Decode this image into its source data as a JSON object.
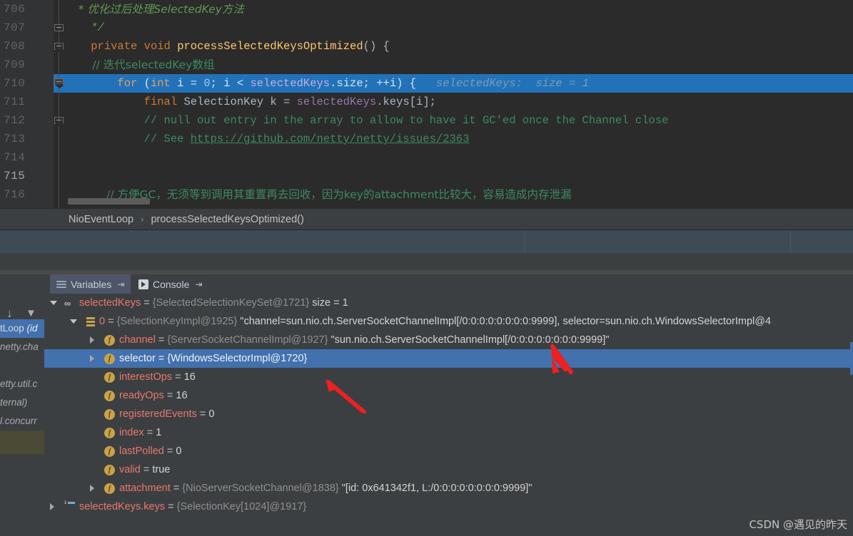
{
  "editor": {
    "lines": [
      {
        "num": "706",
        "segments": [
          {
            "t": "    * 优化过后处理SelectedKey方法",
            "c": "cmt"
          }
        ]
      },
      {
        "num": "707",
        "segments": [
          {
            "t": "    */",
            "c": "cmt"
          }
        ]
      },
      {
        "num": "708",
        "segments": [
          {
            "t": "    ",
            "c": "ident"
          },
          {
            "t": "private",
            "c": "kw"
          },
          {
            "t": " ",
            "c": "ident"
          },
          {
            "t": "void",
            "c": "kw"
          },
          {
            "t": " ",
            "c": "ident"
          },
          {
            "t": "processSelectedKeysOptimized",
            "c": "meth"
          },
          {
            "t": "() {",
            "c": "ident"
          }
        ]
      },
      {
        "num": "709",
        "segments": [
          {
            "t": "        // 迭代selectedKey数组",
            "c": "cmt-plain"
          }
        ]
      },
      {
        "num": "710",
        "segments": [
          {
            "t": "        ",
            "c": "on-hl"
          },
          {
            "t": "for",
            "c": "on-hl-kw"
          },
          {
            "t": " (",
            "c": "on-hl"
          },
          {
            "t": "int",
            "c": "on-hl-kw"
          },
          {
            "t": " i = ",
            "c": "on-hl"
          },
          {
            "t": "0",
            "c": "on-hl-num"
          },
          {
            "t": "; i < ",
            "c": "on-hl"
          },
          {
            "t": "selectedKeys",
            "c": "on-hl-fld"
          },
          {
            "t": ".size; ++i) {",
            "c": "on-hl"
          },
          {
            "t": "   selectedKeys:  size = 1",
            "c": "hint"
          }
        ]
      },
      {
        "num": "711",
        "segments": [
          {
            "t": "            ",
            "c": "ident"
          },
          {
            "t": "final",
            "c": "kw"
          },
          {
            "t": " SelectionKey k = ",
            "c": "ident"
          },
          {
            "t": "selectedKeys",
            "c": "fld"
          },
          {
            "t": ".keys[",
            "c": "ident"
          },
          {
            "t": "i",
            "c": "ident"
          },
          {
            "t": "];",
            "c": "ident"
          }
        ]
      },
      {
        "num": "712",
        "segments": [
          {
            "t": "            // null out entry in the array to allow to have it GC'ed once the Channel close",
            "c": "cmt-plain"
          }
        ]
      },
      {
        "num": "713",
        "segments": [
          {
            "t": "            // See ",
            "c": "cmt-plain"
          },
          {
            "t": "https://github.com/netty/netty/issues/2363",
            "c": "link"
          }
        ]
      },
      {
        "num": "714",
        "segments": []
      },
      {
        "num": "715",
        "segments": []
      },
      {
        "num": "716",
        "segments": [
          {
            "t": "            // 方便GC，无须等到调用其重置再去回收，因为key的attachment比较大，容易造成内存泄漏",
            "c": "cmt-plain"
          }
        ]
      }
    ],
    "highlight_line": "710",
    "inline_hint": "selectedKeys:  size = 1"
  },
  "breadcrumb": {
    "items": [
      "NioEventLoop",
      "processSelectedKeysOptimized()"
    ],
    "separator": "›"
  },
  "debug_tabs": [
    {
      "label": "Variables",
      "icon": "variables-icon",
      "pin": "⇥",
      "active": true
    },
    {
      "label": "Console",
      "icon": "console-icon",
      "pin": "⇥",
      "active": false
    }
  ],
  "left_rail": {
    "buttons": [
      {
        "name": "step-down-icon",
        "glyph": "↓"
      },
      {
        "name": "filter-icon",
        "glyph": "▼"
      }
    ],
    "frames": [
      {
        "text": "tLoop (id",
        "selected": true,
        "lead": "tLoop",
        "tail": " (id"
      },
      {
        "text": "netty.cha",
        "selected": false
      },
      {
        "text": "",
        "selected": false
      },
      {
        "text": "etty.util.c",
        "selected": false
      },
      {
        "text": "ternal)",
        "selected": false
      },
      {
        "text": "l.concurr",
        "selected": false
      }
    ]
  },
  "variables": [
    {
      "indent": 0,
      "twisty": "open",
      "icon": "set-icon",
      "name": "selectedKeys",
      "eq": " = ",
      "type": "{SelectedSelectionKeySet@1721}",
      "meta": "  size = 1",
      "value": "",
      "selected": false
    },
    {
      "indent": 1,
      "twisty": "open",
      "icon": "list-icon",
      "name": "0",
      "eq": " = ",
      "type": "{SelectionKeyImpl@1925}",
      "value": " \"channel=sun.nio.ch.ServerSocketChannelImpl[/0:0:0:0:0:0:0:0:9999], selector=sun.nio.ch.WindowsSelectorImpl@4",
      "meta": "",
      "selected": false
    },
    {
      "indent": 2,
      "twisty": "closed",
      "icon": "field-icon",
      "name": "channel",
      "eq": " = ",
      "type": "{ServerSocketChannelImpl@1927}",
      "value": " \"sun.nio.ch.ServerSocketChannelImpl[/0:0:0:0:0:0:0:0:9999]\"",
      "meta": "",
      "selected": false
    },
    {
      "indent": 2,
      "twisty": "closed",
      "icon": "field-icon",
      "name": "selector",
      "eq": " = ",
      "type": "{WindowsSelectorImpl@1720}",
      "value": "",
      "meta": "",
      "selected": true
    },
    {
      "indent": 2,
      "twisty": "none",
      "icon": "field-icon",
      "name": "interestOps",
      "eq": " = ",
      "type": "",
      "value": "16",
      "meta": "",
      "selected": false
    },
    {
      "indent": 2,
      "twisty": "none",
      "icon": "field-icon",
      "name": "readyOps",
      "eq": " = ",
      "type": "",
      "value": "16",
      "meta": "",
      "selected": false
    },
    {
      "indent": 2,
      "twisty": "none",
      "icon": "field-icon",
      "name": "registeredEvents",
      "eq": " = ",
      "type": "",
      "value": "0",
      "meta": "",
      "selected": false
    },
    {
      "indent": 2,
      "twisty": "none",
      "icon": "field-icon",
      "name": "index",
      "eq": " = ",
      "type": "",
      "value": "1",
      "meta": "",
      "selected": false
    },
    {
      "indent": 2,
      "twisty": "none",
      "icon": "field-icon",
      "name": "lastPolled",
      "eq": " = ",
      "type": "",
      "value": "0",
      "meta": "",
      "selected": false
    },
    {
      "indent": 2,
      "twisty": "none",
      "icon": "field-icon",
      "name": "valid",
      "eq": " = ",
      "type": "",
      "value": "true",
      "meta": "",
      "selected": false
    },
    {
      "indent": 2,
      "twisty": "closed",
      "icon": "field-icon",
      "name": "attachment",
      "eq": " = ",
      "type": "{NioServerSocketChannel@1838}",
      "value": " \"[id: 0x641342f1, L:/0:0:0:0:0:0:0:0:9999]\"",
      "meta": "",
      "selected": false
    },
    {
      "indent": 0,
      "twisty": "closed",
      "icon": "array-icon",
      "name": "selectedKeys.keys",
      "eq": " = ",
      "type": "{SelectionKey[1024]@1917}",
      "value": "",
      "meta": "",
      "selected": false
    }
  ],
  "annotations": {
    "arrow_color": "#ee2020",
    "arrows": [
      {
        "name": "arrow-to-channel-value"
      },
      {
        "name": "arrow-to-interest-ops"
      }
    ]
  },
  "watermark": {
    "text": "CSDN @遇见的昨天"
  },
  "colors": {
    "editor_bg": "#2b2b2b",
    "panel_bg": "#3c3f41",
    "selection_blue": "#2272b9",
    "tree_selection": "#4271ae",
    "strip_blue": "#3d4b57",
    "accent_field": "#c9a34a",
    "name_red": "#e8776d"
  }
}
